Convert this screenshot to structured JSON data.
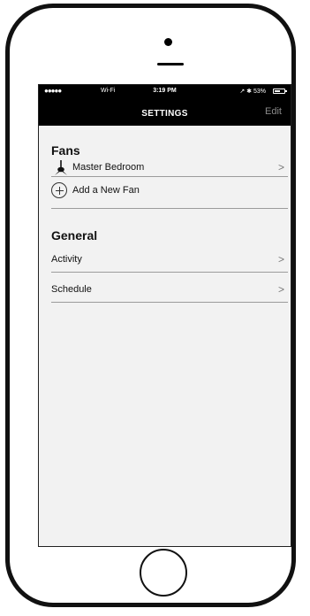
{
  "status_bar": {
    "signal": "●●●●●",
    "wifi": "Wi-Fi",
    "time": "3:19 PM",
    "right": "↗ ✱ 53%"
  },
  "nav": {
    "title": "SETTINGS",
    "edit": "Edit"
  },
  "fans": {
    "header": "Fans",
    "items": [
      {
        "label": "Master Bedroom",
        "icon": "fan-icon"
      }
    ],
    "add_label": "Add a New Fan"
  },
  "general": {
    "header": "General",
    "items": [
      {
        "label": "Activity"
      },
      {
        "label": "Schedule"
      }
    ]
  },
  "chevron": ">"
}
